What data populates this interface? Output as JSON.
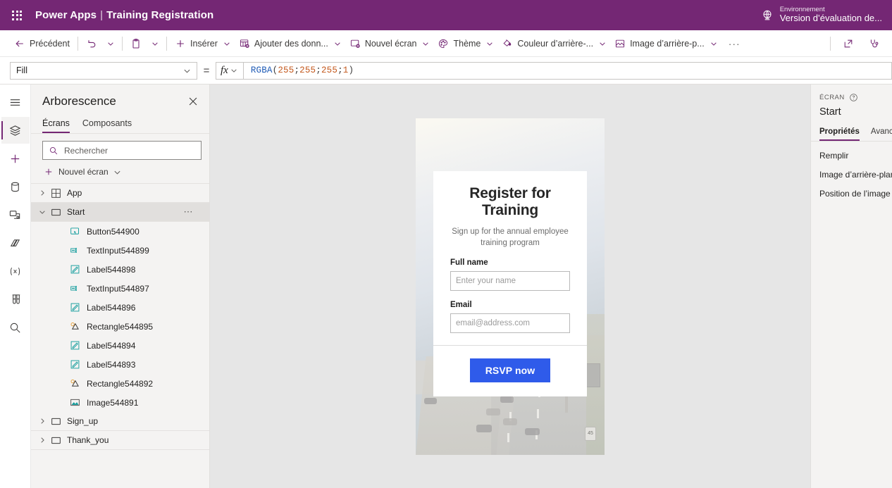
{
  "topbar": {
    "waffle_icon": "app-launcher-icon",
    "product": "Power Apps",
    "separator": "|",
    "app_name": "Training Registration",
    "environment_label": "Environnement",
    "environment_value": "Version d’évaluation de...",
    "environment_icon": "globe-icon",
    "brand_color": "#742774"
  },
  "commandbar": {
    "back": "Précédent",
    "undo_icon": "undo-icon",
    "paste_icon": "paste-icon",
    "insert": "Insérer",
    "add_data": "Ajouter des donn...",
    "new_screen": "Nouvel écran",
    "theme": "Thème",
    "background_color": "Couleur d’arrière-...",
    "background_image": "Image d’arrière-p...",
    "overflow": "···",
    "share_icon": "share-icon",
    "checker_icon": "app-checker-stethoscope-icon"
  },
  "formulabar": {
    "property": "Fill",
    "equals": "=",
    "fx": "fx",
    "formula_fn": "RGBA",
    "formula_open": "(",
    "formula_args": [
      "255",
      "255",
      "255",
      "1"
    ],
    "formula_sep": "; ",
    "formula_close": ")",
    "formula_full": "RGBA(255; 255; 255; 1)"
  },
  "rail": {
    "items": [
      {
        "icon": "hamburger-menu-icon",
        "active": false
      },
      {
        "icon": "tree-view-layers-icon",
        "active": true
      },
      {
        "icon": "insert-plus-icon",
        "active": false
      },
      {
        "icon": "data-cylinder-icon",
        "active": false
      },
      {
        "icon": "media-icon",
        "active": false
      },
      {
        "icon": "power-automate-flow-icon",
        "active": false
      },
      {
        "icon": "variables-x-icon",
        "active": false
      },
      {
        "icon": "test-tubes-icon",
        "active": false
      },
      {
        "icon": "search-icon",
        "active": false
      }
    ]
  },
  "treepanel": {
    "title": "Arborescence",
    "close_icon": "close-icon",
    "tabs": [
      {
        "label": "Écrans",
        "active": true
      },
      {
        "label": "Composants",
        "active": false
      }
    ],
    "search_placeholder": "Rechercher",
    "search_value": "",
    "search_icon": "search-icon",
    "new_screen": "Nouvel écran",
    "new_screen_icon": "plus-icon",
    "items": [
      {
        "label": "App",
        "type": "app",
        "icon": "app-icon",
        "level": 0,
        "expanded": false,
        "selected": false
      },
      {
        "label": "Start",
        "type": "screen",
        "icon": "screen-icon",
        "level": 0,
        "expanded": true,
        "selected": true,
        "more_icon": "more-ellipsis-icon"
      },
      {
        "label": "Button544900",
        "type": "control",
        "icon": "button-icon",
        "level": 1
      },
      {
        "label": "TextInput544899",
        "type": "control",
        "icon": "textinput-icon",
        "level": 1
      },
      {
        "label": "Label544898",
        "type": "control",
        "icon": "label-icon",
        "level": 1
      },
      {
        "label": "TextInput544897",
        "type": "control",
        "icon": "textinput-icon",
        "level": 1
      },
      {
        "label": "Label544896",
        "type": "control",
        "icon": "label-icon",
        "level": 1
      },
      {
        "label": "Rectangle544895",
        "type": "control",
        "icon": "rectangle-icon",
        "level": 1
      },
      {
        "label": "Label544894",
        "type": "control",
        "icon": "label-icon",
        "level": 1
      },
      {
        "label": "Label544893",
        "type": "control",
        "icon": "label-icon",
        "level": 1
      },
      {
        "label": "Rectangle544892",
        "type": "control",
        "icon": "rectangle-icon",
        "level": 1
      },
      {
        "label": "Image544891",
        "type": "control",
        "icon": "image-icon",
        "level": 1
      },
      {
        "label": "Sign_up",
        "type": "screen",
        "icon": "screen-icon",
        "level": 0,
        "expanded": false,
        "selected": false
      },
      {
        "label": "Thank_you",
        "type": "screen",
        "icon": "screen-icon",
        "level": 0,
        "expanded": false,
        "selected": false
      }
    ]
  },
  "canvas": {
    "background_color": "#e6e6e6",
    "app": {
      "title": "Register for Training",
      "subtitle": "Sign up for the annual employee training program",
      "fields": [
        {
          "label": "Full name",
          "placeholder": "Enter your name",
          "value": ""
        },
        {
          "label": "Email",
          "placeholder": "email@address.com",
          "value": ""
        }
      ],
      "submit_label": "RSVP now",
      "submit_color": "#2f5bea",
      "background_image": "highway-traffic-photo",
      "speed_sign": "45"
    }
  },
  "properties": {
    "kicker": "ÉCRAN",
    "help_icon": "help-circle-icon",
    "name": "Start",
    "tabs": [
      {
        "label": "Propriétés",
        "active": true
      },
      {
        "label": "Avancé",
        "active": false
      }
    ],
    "rows": [
      {
        "label": "Remplir"
      },
      {
        "label": "Image d’arrière-plan"
      },
      {
        "label": "Position de l’image"
      }
    ]
  }
}
